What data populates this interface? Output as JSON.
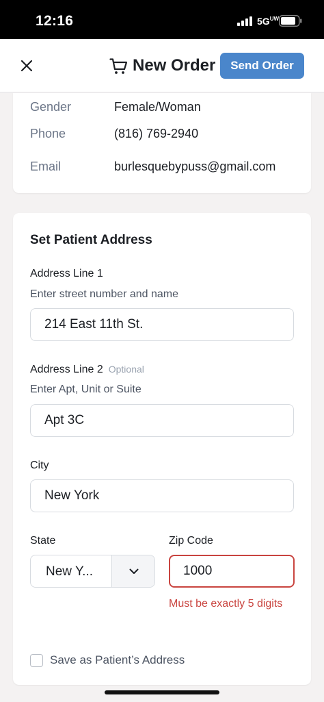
{
  "status_bar": {
    "time": "12:16",
    "network": "5G",
    "network_superscript": "UW"
  },
  "header": {
    "title": "New Order",
    "send_label": "Send Order",
    "close_icon": "close-icon",
    "cart_icon": "cart-icon",
    "accent_color": "#4a86cb"
  },
  "patient_info": {
    "rows": [
      {
        "label": "Gender",
        "value": "Female/Woman"
      },
      {
        "label": "Phone",
        "value": "(816) 769-2940"
      },
      {
        "label": "Email",
        "value": "burlesquebypuss@gmail.com"
      }
    ]
  },
  "address": {
    "title": "Set Patient Address",
    "line1": {
      "label": "Address Line 1",
      "hint": "Enter street number and name",
      "value": "214 East 11th St."
    },
    "line2": {
      "label": "Address Line 2",
      "optional": "Optional",
      "hint": "Enter Apt, Unit or Suite",
      "value": "Apt 3C"
    },
    "city": {
      "label": "City",
      "value": "New York"
    },
    "state": {
      "label": "State",
      "value": "New Y..."
    },
    "zip": {
      "label": "Zip Code",
      "value": "1000",
      "error": "Must be exactly 5 digits",
      "error_color": "#c9443f"
    },
    "save_label": "Save as Patient’s Address"
  }
}
